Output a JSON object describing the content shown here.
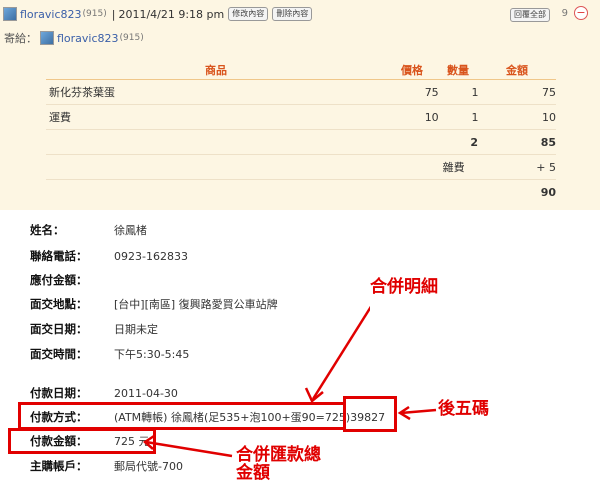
{
  "header": {
    "user": "floravic823",
    "user_count": "(915)",
    "separator": "|",
    "datetime": "2011/4/21  9:18 pm",
    "edit_btn": "修改內容",
    "delete_btn": "刪除內容",
    "reply_all_btn": "回覆全部",
    "reply_count": "9",
    "collapse_symbol": "−"
  },
  "to": {
    "label": "寄給：",
    "user": "floravic823",
    "user_count": "(915)"
  },
  "table": {
    "headers": [
      "商品",
      "價格",
      "數量",
      "金額"
    ],
    "rows": [
      {
        "item": "新化芬茶葉蛋",
        "price": "75",
        "qty": "1",
        "amount": "75"
      },
      {
        "item": "運費",
        "price": "10",
        "qty": "1",
        "amount": "10"
      }
    ],
    "total_qty": "2",
    "subtotal": "85",
    "fee_label": "雜費",
    "fee_value": "+ 5",
    "grand_total": "90"
  },
  "details": [
    {
      "label": "姓名：",
      "value": "徐鳳楮"
    },
    {
      "label": "聯絡電話：",
      "value": "0923-162833"
    },
    {
      "label": "應付金額：",
      "value": ""
    },
    {
      "label": "面交地點：",
      "value": "[台中][南區] 復興路愛買公車站牌"
    },
    {
      "label": "面交日期：",
      "value": "日期未定"
    },
    {
      "label": "面交時間：",
      "value": "下午5:30-5:45"
    },
    {
      "label": "付款日期：",
      "value": "2011-04-30"
    },
    {
      "label": "付款方式：",
      "value": "(ATM轉帳) 徐鳳楮(足535+泡100+蛋90=725)39827"
    },
    {
      "label": "付款金額：",
      "value": "725 元"
    },
    {
      "label": "主購帳戶：",
      "value": "郵局代號-700"
    }
  ],
  "annotations": {
    "merge_detail": "合併明細",
    "last_five": "後五碼",
    "merge_total_line1": "合併匯款總",
    "merge_total_line2": "金額"
  },
  "colors": {
    "panel_bg": "#fdf6e3",
    "header_orange": "#d9541c",
    "annotation_red": "#e10000",
    "link_blue": "#3a5fa8"
  }
}
